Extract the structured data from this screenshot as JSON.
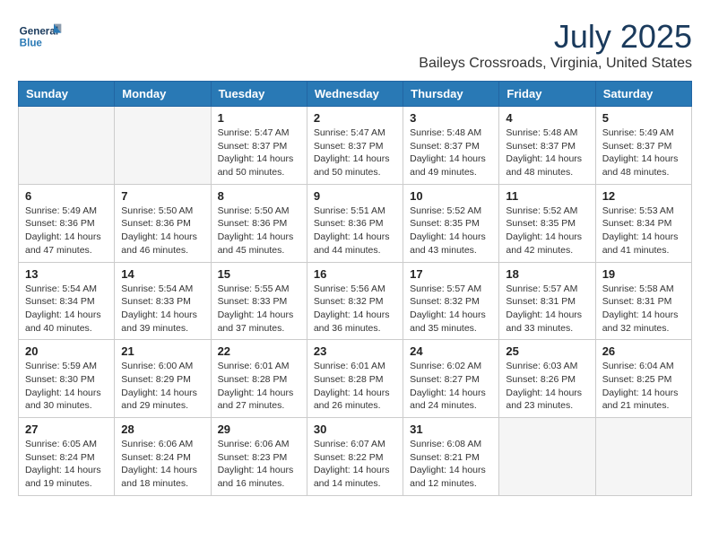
{
  "header": {
    "logo_general": "General",
    "logo_blue": "Blue",
    "month": "July 2025",
    "location": "Baileys Crossroads, Virginia, United States"
  },
  "weekdays": [
    "Sunday",
    "Monday",
    "Tuesday",
    "Wednesday",
    "Thursday",
    "Friday",
    "Saturday"
  ],
  "weeks": [
    [
      {
        "day": "",
        "sunrise": "",
        "sunset": "",
        "daylight": ""
      },
      {
        "day": "",
        "sunrise": "",
        "sunset": "",
        "daylight": ""
      },
      {
        "day": "1",
        "sunrise": "Sunrise: 5:47 AM",
        "sunset": "Sunset: 8:37 PM",
        "daylight": "Daylight: 14 hours and 50 minutes."
      },
      {
        "day": "2",
        "sunrise": "Sunrise: 5:47 AM",
        "sunset": "Sunset: 8:37 PM",
        "daylight": "Daylight: 14 hours and 50 minutes."
      },
      {
        "day": "3",
        "sunrise": "Sunrise: 5:48 AM",
        "sunset": "Sunset: 8:37 PM",
        "daylight": "Daylight: 14 hours and 49 minutes."
      },
      {
        "day": "4",
        "sunrise": "Sunrise: 5:48 AM",
        "sunset": "Sunset: 8:37 PM",
        "daylight": "Daylight: 14 hours and 48 minutes."
      },
      {
        "day": "5",
        "sunrise": "Sunrise: 5:49 AM",
        "sunset": "Sunset: 8:37 PM",
        "daylight": "Daylight: 14 hours and 48 minutes."
      }
    ],
    [
      {
        "day": "6",
        "sunrise": "Sunrise: 5:49 AM",
        "sunset": "Sunset: 8:36 PM",
        "daylight": "Daylight: 14 hours and 47 minutes."
      },
      {
        "day": "7",
        "sunrise": "Sunrise: 5:50 AM",
        "sunset": "Sunset: 8:36 PM",
        "daylight": "Daylight: 14 hours and 46 minutes."
      },
      {
        "day": "8",
        "sunrise": "Sunrise: 5:50 AM",
        "sunset": "Sunset: 8:36 PM",
        "daylight": "Daylight: 14 hours and 45 minutes."
      },
      {
        "day": "9",
        "sunrise": "Sunrise: 5:51 AM",
        "sunset": "Sunset: 8:36 PM",
        "daylight": "Daylight: 14 hours and 44 minutes."
      },
      {
        "day": "10",
        "sunrise": "Sunrise: 5:52 AM",
        "sunset": "Sunset: 8:35 PM",
        "daylight": "Daylight: 14 hours and 43 minutes."
      },
      {
        "day": "11",
        "sunrise": "Sunrise: 5:52 AM",
        "sunset": "Sunset: 8:35 PM",
        "daylight": "Daylight: 14 hours and 42 minutes."
      },
      {
        "day": "12",
        "sunrise": "Sunrise: 5:53 AM",
        "sunset": "Sunset: 8:34 PM",
        "daylight": "Daylight: 14 hours and 41 minutes."
      }
    ],
    [
      {
        "day": "13",
        "sunrise": "Sunrise: 5:54 AM",
        "sunset": "Sunset: 8:34 PM",
        "daylight": "Daylight: 14 hours and 40 minutes."
      },
      {
        "day": "14",
        "sunrise": "Sunrise: 5:54 AM",
        "sunset": "Sunset: 8:33 PM",
        "daylight": "Daylight: 14 hours and 39 minutes."
      },
      {
        "day": "15",
        "sunrise": "Sunrise: 5:55 AM",
        "sunset": "Sunset: 8:33 PM",
        "daylight": "Daylight: 14 hours and 37 minutes."
      },
      {
        "day": "16",
        "sunrise": "Sunrise: 5:56 AM",
        "sunset": "Sunset: 8:32 PM",
        "daylight": "Daylight: 14 hours and 36 minutes."
      },
      {
        "day": "17",
        "sunrise": "Sunrise: 5:57 AM",
        "sunset": "Sunset: 8:32 PM",
        "daylight": "Daylight: 14 hours and 35 minutes."
      },
      {
        "day": "18",
        "sunrise": "Sunrise: 5:57 AM",
        "sunset": "Sunset: 8:31 PM",
        "daylight": "Daylight: 14 hours and 33 minutes."
      },
      {
        "day": "19",
        "sunrise": "Sunrise: 5:58 AM",
        "sunset": "Sunset: 8:31 PM",
        "daylight": "Daylight: 14 hours and 32 minutes."
      }
    ],
    [
      {
        "day": "20",
        "sunrise": "Sunrise: 5:59 AM",
        "sunset": "Sunset: 8:30 PM",
        "daylight": "Daylight: 14 hours and 30 minutes."
      },
      {
        "day": "21",
        "sunrise": "Sunrise: 6:00 AM",
        "sunset": "Sunset: 8:29 PM",
        "daylight": "Daylight: 14 hours and 29 minutes."
      },
      {
        "day": "22",
        "sunrise": "Sunrise: 6:01 AM",
        "sunset": "Sunset: 8:28 PM",
        "daylight": "Daylight: 14 hours and 27 minutes."
      },
      {
        "day": "23",
        "sunrise": "Sunrise: 6:01 AM",
        "sunset": "Sunset: 8:28 PM",
        "daylight": "Daylight: 14 hours and 26 minutes."
      },
      {
        "day": "24",
        "sunrise": "Sunrise: 6:02 AM",
        "sunset": "Sunset: 8:27 PM",
        "daylight": "Daylight: 14 hours and 24 minutes."
      },
      {
        "day": "25",
        "sunrise": "Sunrise: 6:03 AM",
        "sunset": "Sunset: 8:26 PM",
        "daylight": "Daylight: 14 hours and 23 minutes."
      },
      {
        "day": "26",
        "sunrise": "Sunrise: 6:04 AM",
        "sunset": "Sunset: 8:25 PM",
        "daylight": "Daylight: 14 hours and 21 minutes."
      }
    ],
    [
      {
        "day": "27",
        "sunrise": "Sunrise: 6:05 AM",
        "sunset": "Sunset: 8:24 PM",
        "daylight": "Daylight: 14 hours and 19 minutes."
      },
      {
        "day": "28",
        "sunrise": "Sunrise: 6:06 AM",
        "sunset": "Sunset: 8:24 PM",
        "daylight": "Daylight: 14 hours and 18 minutes."
      },
      {
        "day": "29",
        "sunrise": "Sunrise: 6:06 AM",
        "sunset": "Sunset: 8:23 PM",
        "daylight": "Daylight: 14 hours and 16 minutes."
      },
      {
        "day": "30",
        "sunrise": "Sunrise: 6:07 AM",
        "sunset": "Sunset: 8:22 PM",
        "daylight": "Daylight: 14 hours and 14 minutes."
      },
      {
        "day": "31",
        "sunrise": "Sunrise: 6:08 AM",
        "sunset": "Sunset: 8:21 PM",
        "daylight": "Daylight: 14 hours and 12 minutes."
      },
      {
        "day": "",
        "sunrise": "",
        "sunset": "",
        "daylight": ""
      },
      {
        "day": "",
        "sunrise": "",
        "sunset": "",
        "daylight": ""
      }
    ]
  ]
}
